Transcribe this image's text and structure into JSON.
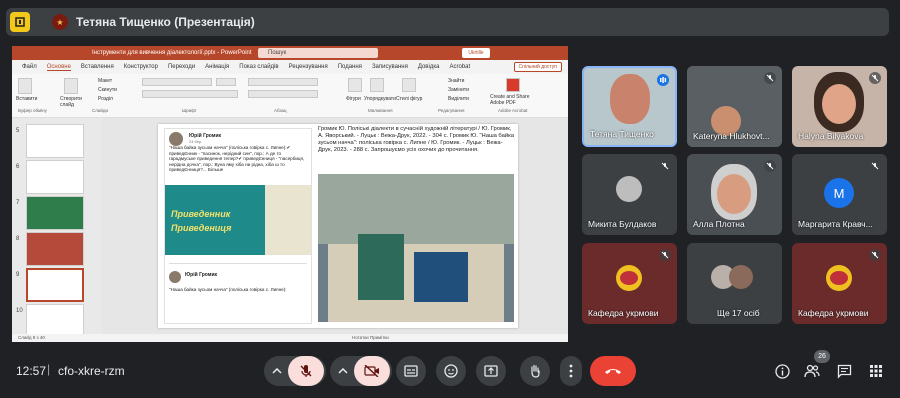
{
  "header": {
    "presenter_title": "Тетяна Тищенко (Презентація)"
  },
  "ppt": {
    "file_name": "Інструменти для вивчення діалектології.pptx - PowerPoint",
    "search_placeholder": "Пошук",
    "user_label": "Ukrtille",
    "share_label": "Спільний доступ",
    "tabs": [
      "Файл",
      "Основне",
      "Вставлення",
      "Конструктор",
      "Переходи",
      "Анімація",
      "Показ слайдів",
      "Рецензування",
      "Подання",
      "Записування",
      "Довідка",
      "Acrobat"
    ],
    "ribbon_groups": [
      "Буфер обміну",
      "Слайди",
      "Шрифт",
      "Абзац",
      "Малювання",
      "Редагування",
      "Adobe Acrobat"
    ],
    "ribbon_items": [
      "Вставити",
      "Створити слайд",
      "Макет",
      "Скинути",
      "Розділ",
      "Фігури",
      "Упорядкувати",
      "Стилі фігур",
      "Знайти",
      "Замінити",
      "Виділити",
      "Create and Share Adobe PDF"
    ],
    "thumb_numbers": [
      "5",
      "6",
      "7",
      "8",
      "9",
      "10"
    ],
    "post_author": "Юрій Громик",
    "post_time": "24 бер.",
    "post_text": "\"Наша байка зусьом начча\" (поліська говірка с. Липне):✔ приведЄнник - \"пасинок, нерідний син\", пор.: А де то гарадмуське приведення тепер?✔ приведЄнниця - \"пасербиця, нерідна дочка\", пор.: Вуна яму хіба ни рідна, хіба ш то приведЄнниця?... Більше",
    "post_image_line1": "Приведенник",
    "post_image_line2": "Приведениця",
    "post2_author": "Юрій Громик",
    "post2_text": "\"Наша байка зусьом начча\" (поліська говірка с. Липне):",
    "caption": "Громик Ю. Поліські діалекти в сучасній художній літературі / Ю. Громик, А. Яворський. - Луцьк : Вежа-Друк, 2022. - 304 с. Громик Ю. \"Наша байка зусьом начча\": поліська говірка с. Липне / Ю. Громик. - Луцьк : Вежа-Друк, 2023. - 288 с. Запрошуємо усіх охочих до прочитання.",
    "status_left": "Слайд 9 з 40",
    "status_right": "Нотатки   Примітки"
  },
  "participants": [
    {
      "name": "Тетяна Тищенко"
    },
    {
      "name": "Kateryna Hlukhovt..."
    },
    {
      "name": "Halyna Bilyakova"
    },
    {
      "name": "Микита Булдаков"
    },
    {
      "name": "Алла Плотна"
    },
    {
      "name": "Маргарита Кравч..."
    },
    {
      "name": "Кафедра укрмови"
    },
    {
      "name": "Ще 17 осіб"
    },
    {
      "name": "Кафедра укрмови"
    }
  ],
  "avatar_letter": "M",
  "footer": {
    "time": "12:57",
    "separator": "|",
    "meeting_code": "cfo-xkre-rzm",
    "participant_count": "26"
  }
}
